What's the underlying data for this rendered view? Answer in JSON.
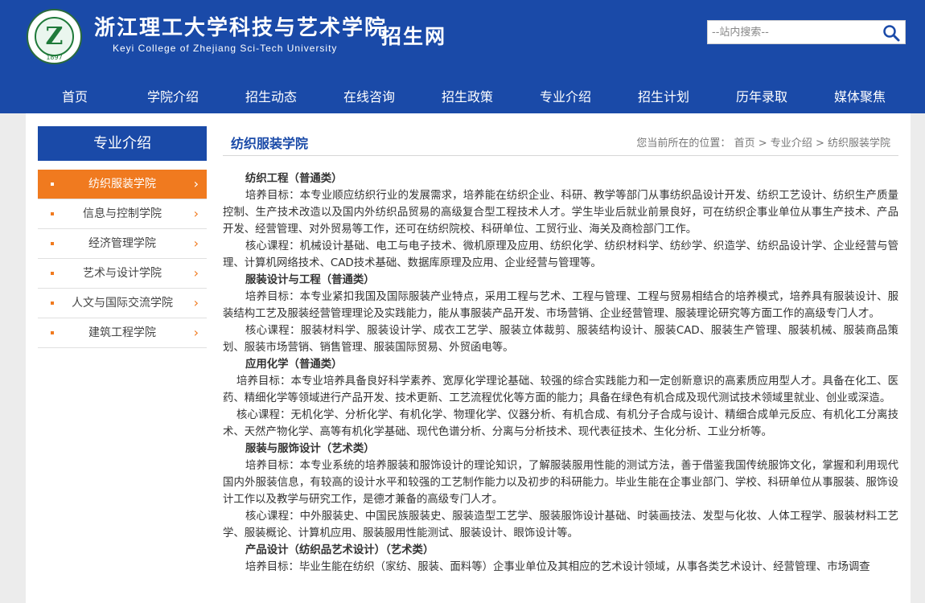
{
  "header": {
    "logo_year": "1897",
    "school_cn": "浙江理工大学科技与艺术学院",
    "school_en": "Keyi College of Zhejiang Sci-Tech University",
    "site_name": "招生网",
    "search_placeholder": "--站内搜索--"
  },
  "nav": [
    "首页",
    "学院介绍",
    "招生动态",
    "在线咨询",
    "招生政策",
    "专业介绍",
    "招生计划",
    "历年录取",
    "媒体聚焦"
  ],
  "sidebar": {
    "title": "专业介绍",
    "items": [
      {
        "label": "纺织服装学院",
        "active": true
      },
      {
        "label": "信息与控制学院",
        "active": false
      },
      {
        "label": "经济管理学院",
        "active": false
      },
      {
        "label": "艺术与设计学院",
        "active": false
      },
      {
        "label": "人文与国际交流学院",
        "active": false
      },
      {
        "label": "建筑工程学院",
        "active": false
      }
    ]
  },
  "main": {
    "title": "纺织服装学院",
    "breadcrumb": {
      "prefix": "您当前所在的位置：",
      "items": [
        "首页",
        "专业介绍",
        "纺织服装学院"
      ],
      "separator": ">"
    }
  },
  "article": {
    "p1_h": "纺织工程（普通类）",
    "p1_goal": "培养目标：本专业顺应纺织行业的发展需求，培养能在纺织企业、科研、教学等部门从事纺织品设计开发、纺织工艺设计、纺织生产质量控制、生产技术改造以及国内外纺织品贸易的高级复合型工程技术人才。学生毕业后就业前景良好，可在纺织企事业单位从事生产技术、产品开发、经营管理、对外贸易等工作，还可在纺织院校、科研单位、工贸行业、海关及商检部门工作。",
    "p1_course": "核心课程：机械设计基础、电工与电子技术、微机原理及应用、纺织化学、纺织材料学、纺纱学、织造学、纺织品设计学、企业经营与管理、计算机网络技术、CAD技术基础、数据库原理及应用、企业经营与管理等。",
    "p2_h": "服装设计与工程（普通类）",
    "p2_goal": "培养目标：本专业紧扣我国及国际服装产业特点，采用工程与艺术、工程与管理、工程与贸易相结合的培养模式，培养具有服装设计、服装结构工艺及服装经营管理理论及实践能力，能从事服装产品开发、市场营销、企业经营管理、服装理论研究等方面工作的高级专门人才。",
    "p2_course": "核心课程：服装材料学、服装设计学、成衣工艺学、服装立体裁剪、服装结构设计、服装CAD、服装生产管理、服装机械、服装商品策划、服装市场营销、销售管理、服装国际贸易、外贸函电等。",
    "p3_h": "应用化学（普通类）",
    "p3_goal": "培养目标：本专业培养具备良好科学素养、宽厚化学理论基础、较强的综合实践能力和一定创新意识的高素质应用型人才。具备在化工、医药、精细化学等领域进行产品开发、技术更新、工艺流程优化等方面的能力；具备在绿色有机合成及现代测试技术领域里就业、创业或深造。",
    "p3_course": "核心课程：无机化学、分析化学、有机化学、物理化学、仪器分析、有机合成、有机分子合成与设计、精细合成单元反应、有机化工分离技术、天然产物化学、高等有机化学基础、现代色谱分析、分离与分析技术、现代表征技术、生化分析、工业分析等。",
    "p4_h": "服装与服饰设计（艺术类）",
    "p4_goal": "培养目标：本专业系统的培养服装和服饰设计的理论知识，了解服装服用性能的测试方法，善于借鉴我国传统服饰文化，掌握和利用现代国内外服装信息，有较高的设计水平和较强的工艺制作能力以及初步的科研能力。毕业生能在企事业部门、学校、科研单位从事服装、服饰设计工作以及教学与研究工作，是德才兼备的高级专门人才。",
    "p4_course": "核心课程：中外服装史、中国民族服装史、服装造型工艺学、服装服饰设计基础、时装画技法、发型与化妆、人体工程学、服装材料工艺学、服装概论、计算机应用、服装服用性能测试、服装设计、眼饰设计等。",
    "p5_h": "产品设计（纺织品艺术设计）（艺术类）",
    "p5_goal": "培养目标：毕业生能在纺织（家纺、服装、面料等）企事业单位及其相应的艺术设计领域，从事各类艺术设计、经营管理、市场调查"
  }
}
